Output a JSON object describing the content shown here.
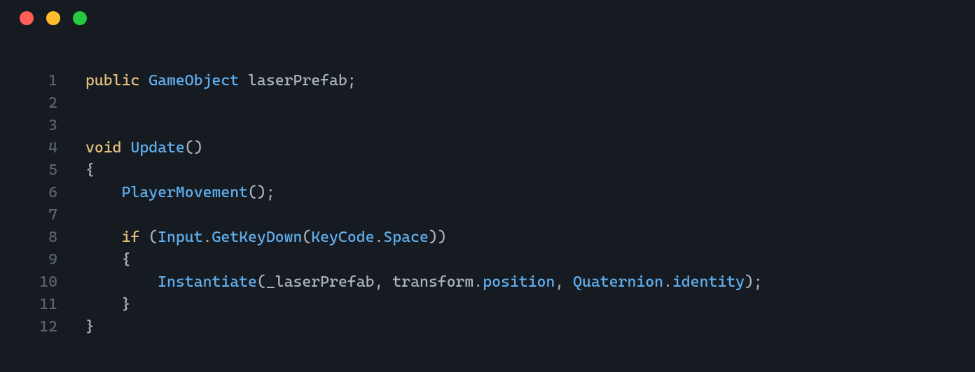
{
  "window": {
    "traffic_lights": [
      "red",
      "yellow",
      "green"
    ]
  },
  "editor": {
    "line_numbers": [
      "1",
      "2",
      "3",
      "4",
      "5",
      "6",
      "7",
      "8",
      "9",
      "10",
      "11",
      "12"
    ],
    "lines": [
      [
        {
          "c": "kw",
          "t": "public"
        },
        {
          "c": "",
          "t": " "
        },
        {
          "c": "type",
          "t": "GameObject"
        },
        {
          "c": "",
          "t": " "
        },
        {
          "c": "ident",
          "t": "laserPrefab"
        },
        {
          "c": "punc",
          "t": ";"
        }
      ],
      [],
      [],
      [
        {
          "c": "kw",
          "t": "void"
        },
        {
          "c": "",
          "t": " "
        },
        {
          "c": "func",
          "t": "Update"
        },
        {
          "c": "punc",
          "t": "()"
        }
      ],
      [
        {
          "c": "punc",
          "t": "{"
        }
      ],
      [
        {
          "c": "",
          "t": "    "
        },
        {
          "c": "func",
          "t": "PlayerMovement"
        },
        {
          "c": "punc",
          "t": "();"
        }
      ],
      [],
      [
        {
          "c": "",
          "t": "    "
        },
        {
          "c": "kw",
          "t": "if"
        },
        {
          "c": "",
          "t": " "
        },
        {
          "c": "punc",
          "t": "("
        },
        {
          "c": "type",
          "t": "Input"
        },
        {
          "c": "punc",
          "t": "."
        },
        {
          "c": "func",
          "t": "GetKeyDown"
        },
        {
          "c": "punc",
          "t": "("
        },
        {
          "c": "type",
          "t": "KeyCode"
        },
        {
          "c": "punc",
          "t": "."
        },
        {
          "c": "prop",
          "t": "Space"
        },
        {
          "c": "punc",
          "t": "))"
        }
      ],
      [
        {
          "c": "",
          "t": "    "
        },
        {
          "c": "punc",
          "t": "{"
        }
      ],
      [
        {
          "c": "",
          "t": "        "
        },
        {
          "c": "func",
          "t": "Instantiate"
        },
        {
          "c": "punc",
          "t": "("
        },
        {
          "c": "ident",
          "t": "_laserPrefab"
        },
        {
          "c": "punc",
          "t": ", "
        },
        {
          "c": "ident",
          "t": "transform"
        },
        {
          "c": "punc",
          "t": "."
        },
        {
          "c": "prop",
          "t": "position"
        },
        {
          "c": "punc",
          "t": ", "
        },
        {
          "c": "type",
          "t": "Quaternion"
        },
        {
          "c": "punc",
          "t": "."
        },
        {
          "c": "prop",
          "t": "identity"
        },
        {
          "c": "punc",
          "t": ");"
        }
      ],
      [
        {
          "c": "",
          "t": "    "
        },
        {
          "c": "punc",
          "t": "}"
        }
      ],
      [
        {
          "c": "punc",
          "t": "}"
        }
      ]
    ]
  }
}
